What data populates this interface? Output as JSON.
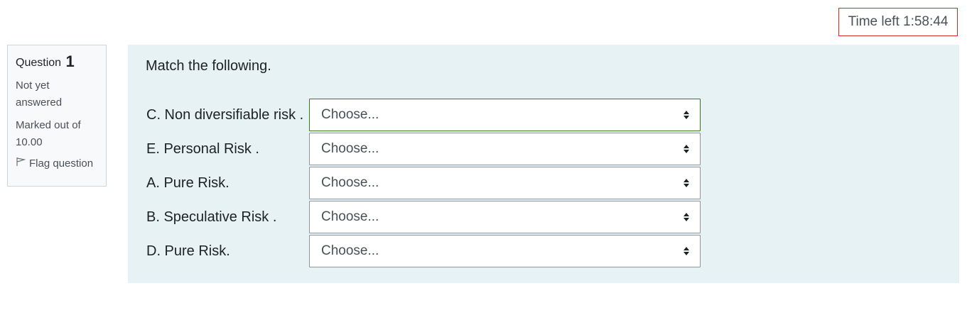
{
  "timer": {
    "label": "Time left 1:58:44"
  },
  "question_info": {
    "label": "Question",
    "number": "1",
    "state": "Not yet answered",
    "grade": "Marked out of 10.00",
    "flag_label": "Flag question",
    "flag_icon": "flag-icon"
  },
  "question": {
    "text": "Match the following.",
    "rows": [
      {
        "label": "C. Non diversifiable risk .",
        "selected": "Choose..."
      },
      {
        "label": "E. Personal Risk .",
        "selected": "Choose..."
      },
      {
        "label": "A. Pure Risk.",
        "selected": "Choose..."
      },
      {
        "label": "B. Speculative Risk .",
        "selected": "Choose..."
      },
      {
        "label": "D. Pure Risk.",
        "selected": "Choose..."
      }
    ]
  },
  "colors": {
    "timer_border": "#ca3120",
    "content_bg": "#e7f2f5",
    "focused_select_border": "#3b7a1a"
  }
}
